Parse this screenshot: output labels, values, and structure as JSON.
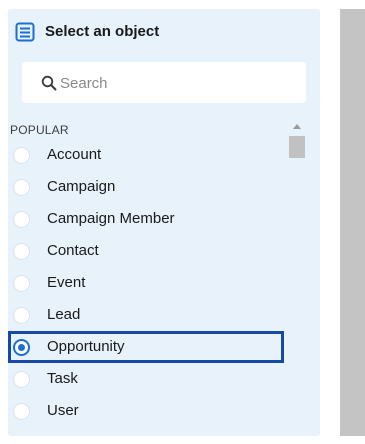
{
  "panel": {
    "title": "Select an object",
    "icon": "list-icon",
    "accent_color": "#1c6fd1",
    "background_color": "#e8f2fb"
  },
  "search": {
    "placeholder": "Search",
    "value": "",
    "icon": "search-icon"
  },
  "section": {
    "label": "POPULAR"
  },
  "items": [
    {
      "label": "Account",
      "checked": false
    },
    {
      "label": "Campaign",
      "checked": false
    },
    {
      "label": "Campaign Member",
      "checked": false
    },
    {
      "label": "Contact",
      "checked": false
    },
    {
      "label": "Event",
      "checked": false
    },
    {
      "label": "Lead",
      "checked": false
    },
    {
      "label": "Opportunity",
      "checked": true
    },
    {
      "label": "Task",
      "checked": false
    },
    {
      "label": "User",
      "checked": false
    }
  ],
  "highlight_color": "#1648a8"
}
